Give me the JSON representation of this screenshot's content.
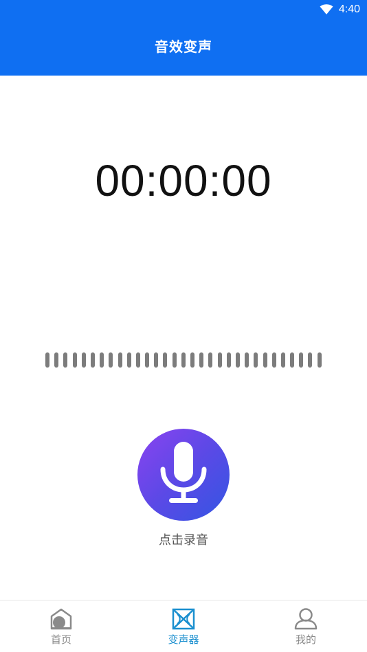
{
  "status_bar": {
    "time": "4:40",
    "icons": [
      "wifi-icon"
    ]
  },
  "header": {
    "title": "音效变声"
  },
  "recorder": {
    "timer": "00:00:00",
    "record_label": "点击录音",
    "record_icon": "microphone-icon",
    "waveform_bar_count": 31
  },
  "bottom_nav": {
    "items": [
      {
        "label": "首页",
        "icon": "home-icon",
        "active": false
      },
      {
        "label": "变声器",
        "icon": "voice-changer-icon",
        "active": true
      },
      {
        "label": "我的",
        "icon": "profile-icon",
        "active": false
      }
    ]
  },
  "colors": {
    "primary": "#0f6ff2",
    "active_nav": "#1a8fcf",
    "inactive_nav": "#8a8a8a",
    "waveform": "#7c7c7c",
    "record_gradient_start": "#8a43f0",
    "record_gradient_end": "#3356e3"
  }
}
